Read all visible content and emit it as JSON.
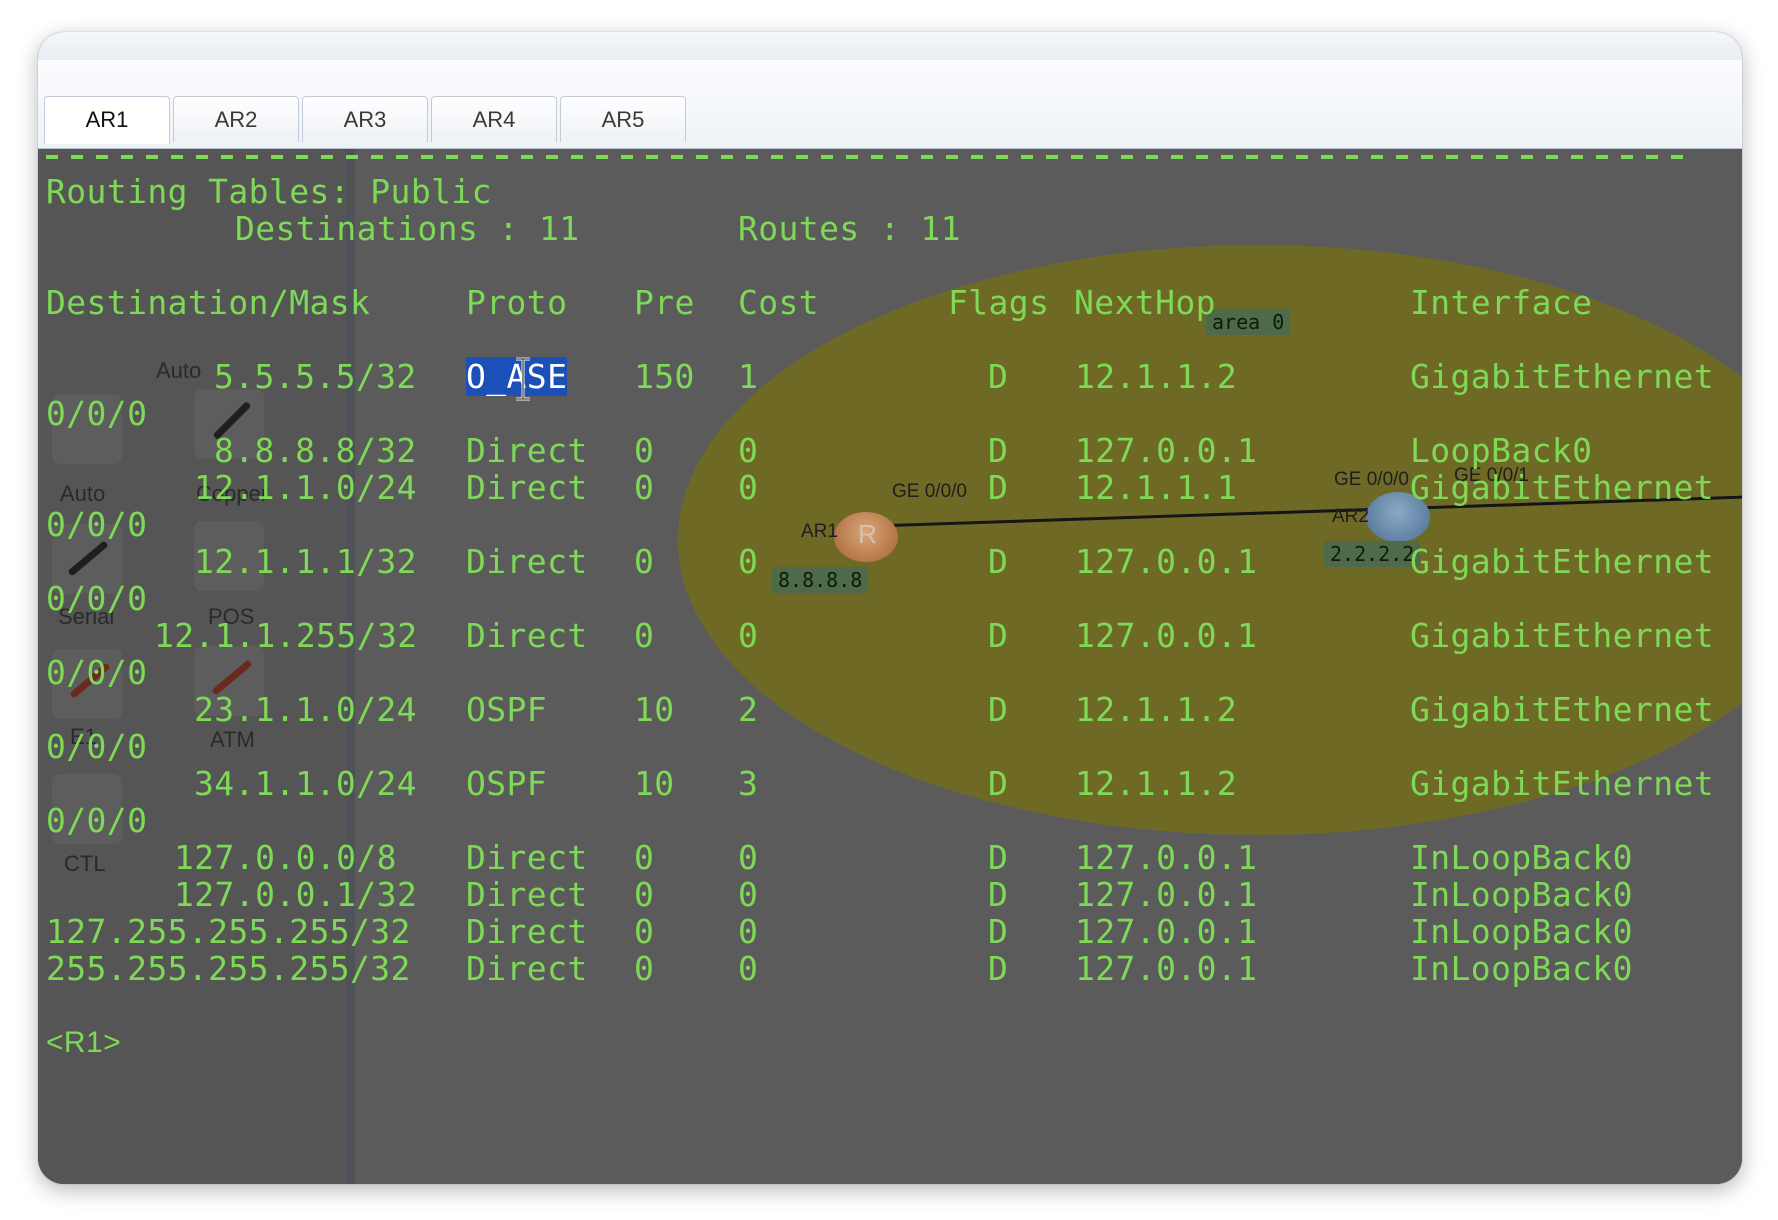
{
  "tabs": [
    {
      "label": "AR1",
      "active": true
    },
    {
      "label": "AR2",
      "active": false
    },
    {
      "label": "AR3",
      "active": false
    },
    {
      "label": "AR4",
      "active": false
    },
    {
      "label": "AR5",
      "active": false
    }
  ],
  "background_canvas": {
    "palette_labels": [
      "Auto",
      "Auto",
      "Copper",
      "Serial",
      "POS",
      "E1",
      "ATM",
      "CTL"
    ],
    "area_label": "area 0",
    "routers": [
      {
        "name": "AR1",
        "glyph": "R",
        "loopback_tag": "8.8.8.8",
        "port": "GE 0/0/0"
      },
      {
        "name": "AR2",
        "loopback_tag": "2.2.2.2",
        "ports": [
          "GE 0/0/0",
          "GE 0/0/1"
        ]
      }
    ]
  },
  "console": {
    "title_line": "Routing Tables: Public",
    "destinations_label": "Destinations : 11",
    "routes_label": "Routes : 11",
    "headers": {
      "destination": "Destination/Mask",
      "proto": "Proto",
      "pre": "Pre",
      "cost": "Cost",
      "flags": "Flags",
      "nexthop": "NextHop",
      "interface": "Interface"
    },
    "rows": [
      {
        "dest": "5.5.5.5/32",
        "proto": "O_ASE",
        "pre": "150",
        "cost": "1",
        "flags": "D",
        "nexthop": "12.1.1.2",
        "interface": "GigabitEthernet",
        "wrap": "0/0/0",
        "selected": "proto"
      },
      {
        "dest": "8.8.8.8/32",
        "proto": "Direct",
        "pre": "0",
        "cost": "0",
        "flags": "D",
        "nexthop": "127.0.0.1",
        "interface": "LoopBack0"
      },
      {
        "dest": "12.1.1.0/24",
        "proto": "Direct",
        "pre": "0",
        "cost": "0",
        "flags": "D",
        "nexthop": "12.1.1.1",
        "interface": "GigabitEthernet",
        "wrap": "0/0/0"
      },
      {
        "dest": "12.1.1.1/32",
        "proto": "Direct",
        "pre": "0",
        "cost": "0",
        "flags": "D",
        "nexthop": "127.0.0.1",
        "interface": "GigabitEthernet",
        "wrap": "0/0/0"
      },
      {
        "dest": "12.1.1.255/32",
        "proto": "Direct",
        "pre": "0",
        "cost": "0",
        "flags": "D",
        "nexthop": "127.0.0.1",
        "interface": "GigabitEthernet",
        "wrap": "0/0/0"
      },
      {
        "dest": "23.1.1.0/24",
        "proto": "OSPF",
        "pre": "10",
        "cost": "2",
        "flags": "D",
        "nexthop": "12.1.1.2",
        "interface": "GigabitEthernet",
        "wrap": "0/0/0"
      },
      {
        "dest": "34.1.1.0/24",
        "proto": "OSPF",
        "pre": "10",
        "cost": "3",
        "flags": "D",
        "nexthop": "12.1.1.2",
        "interface": "GigabitEthernet",
        "wrap": "0/0/0"
      },
      {
        "dest": "127.0.0.0/8",
        "proto": "Direct",
        "pre": "0",
        "cost": "0",
        "flags": "D",
        "nexthop": "127.0.0.1",
        "interface": "InLoopBack0"
      },
      {
        "dest": "127.0.0.1/32",
        "proto": "Direct",
        "pre": "0",
        "cost": "0",
        "flags": "D",
        "nexthop": "127.0.0.1",
        "interface": "InLoopBack0"
      },
      {
        "dest": "127.255.255.255/32",
        "proto": "Direct",
        "pre": "0",
        "cost": "0",
        "flags": "D",
        "nexthop": "127.0.0.1",
        "interface": "InLoopBack0"
      },
      {
        "dest": "255.255.255.255/32",
        "proto": "Direct",
        "pre": "0",
        "cost": "0",
        "flags": "D",
        "nexthop": "127.0.0.1",
        "interface": "InLoopBack0"
      }
    ],
    "prompt": "<R1>"
  },
  "colors": {
    "console_text": "#7ed957",
    "console_bg": "#5b5b5b",
    "selection": "#1c50b9",
    "area_fill": "#6e6a26"
  }
}
